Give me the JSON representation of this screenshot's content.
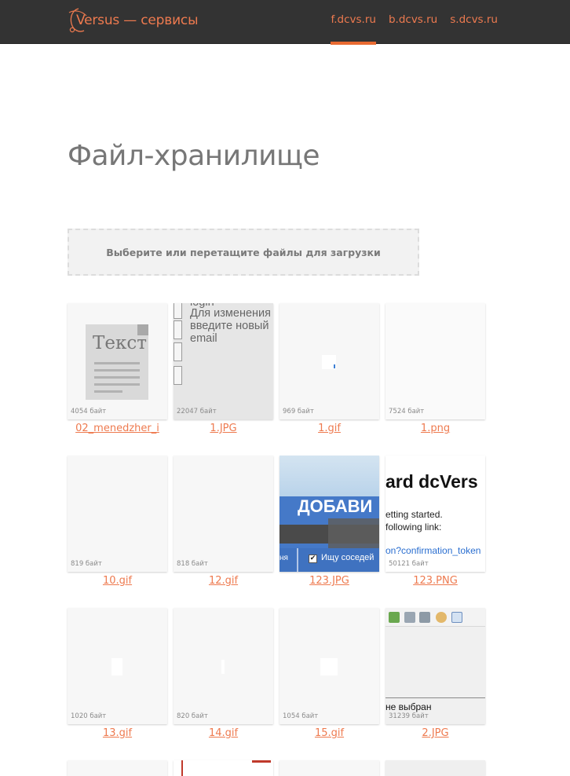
{
  "header": {
    "brand": "Versus — сервисы",
    "nav": [
      {
        "label": "f.dcvs.ru",
        "active": true
      },
      {
        "label": "b.dcvs.ru",
        "active": false
      },
      {
        "label": "s.dcvs.ru",
        "active": false
      }
    ]
  },
  "page_title": "Файл-хранилище",
  "upload": {
    "label": "Выберите или перетащите файлы для загрузки"
  },
  "files": [
    {
      "name": "02_menedzher_i",
      "size": "4054 байт",
      "preview": "document",
      "doc_word": "Текст"
    },
    {
      "name": "1.JPG",
      "size": "22047 байт",
      "preview": "form",
      "lines": [
        "login",
        "Для изменения",
        "введите новый",
        "email"
      ]
    },
    {
      "name": "1.gif",
      "size": "969 байт",
      "preview": "blank"
    },
    {
      "name": "1.png",
      "size": "7524 байт",
      "preview": "blank"
    },
    {
      "name": "10.gif",
      "size": "819 байт",
      "preview": "blank"
    },
    {
      "name": "12.gif",
      "size": "818 байт",
      "preview": "blank"
    },
    {
      "name": "123.JPG",
      "size": "",
      "preview": "banner",
      "banner_text": "ДОБАВИ",
      "check_text": "Ищу соседей",
      "left_text": "ня"
    },
    {
      "name": "123.PNG",
      "size": "50121 байт",
      "preview": "email",
      "title": "ard dcVers",
      "line1": "etting started.",
      "line2": "following link:",
      "link": "on?confirmation_token"
    },
    {
      "name": "13.gif",
      "size": "1020 байт",
      "preview": "blank"
    },
    {
      "name": "14.gif",
      "size": "820 байт",
      "preview": "blank"
    },
    {
      "name": "15.gif",
      "size": "1054 байт",
      "preview": "blank"
    },
    {
      "name": "2.JPG",
      "size": "31239 байт",
      "preview": "toolbar",
      "text": "не выбран"
    }
  ]
}
